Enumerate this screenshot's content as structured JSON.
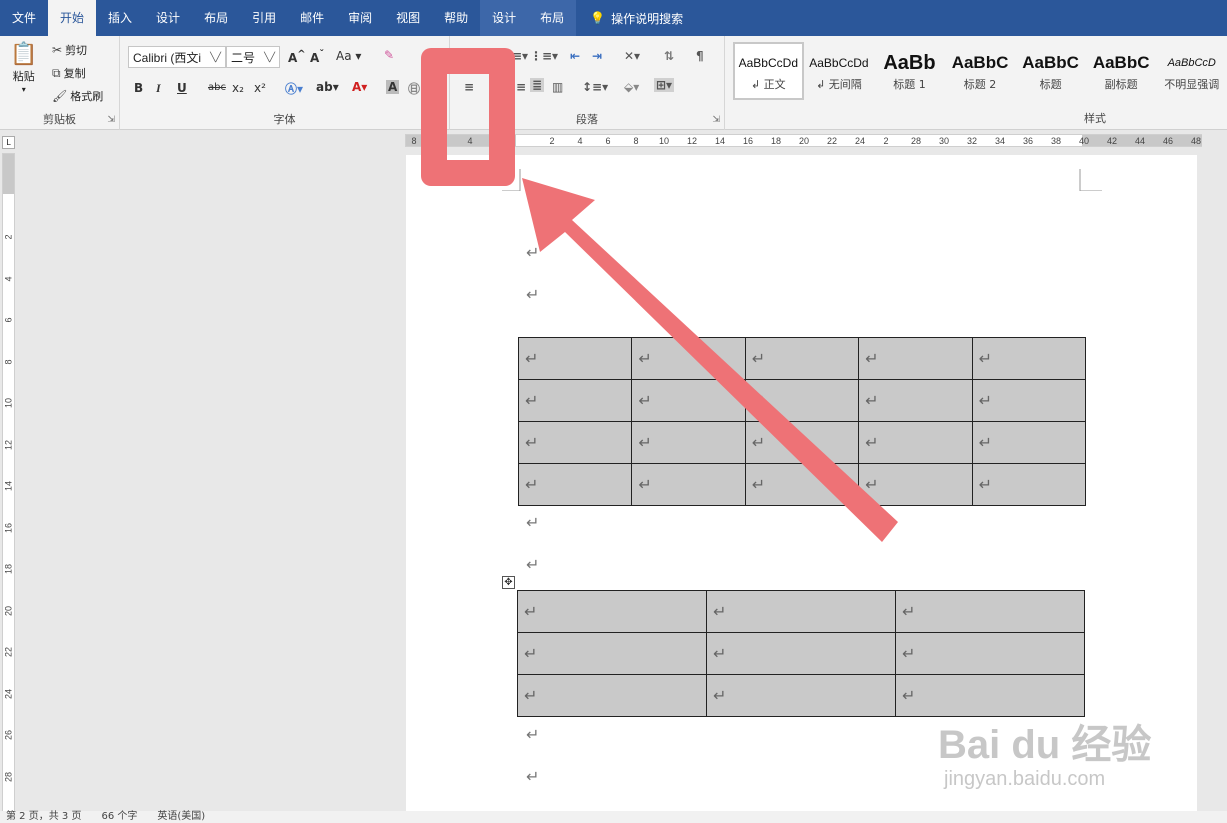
{
  "tabs": [
    "文件",
    "开始",
    "插入",
    "设计",
    "布局",
    "引用",
    "邮件",
    "审阅",
    "视图",
    "帮助",
    "设计",
    "布局"
  ],
  "active_tab_index": 1,
  "tell_me": "操作说明搜索",
  "clipboard": {
    "paste": "粘贴",
    "cut": "剪切",
    "copy": "复制",
    "format_painter": "格式刷",
    "label": "剪贴板"
  },
  "font": {
    "name": "Calibri (西文i",
    "size": "二号",
    "grow": "A",
    "shrink": "A",
    "case": "Aa",
    "bold": "B",
    "italic": "I",
    "underline": "U",
    "strike": "abc",
    "subscript": "x₂",
    "superscript": "x²",
    "label": "字体"
  },
  "paragraph": {
    "label": "段落"
  },
  "styles": {
    "label": "样式",
    "items": [
      {
        "sample": "AaBbCcDd",
        "name": "↲ 正文"
      },
      {
        "sample": "AaBbCcDd",
        "name": "↲ 无间隔"
      },
      {
        "sample": "AaBb",
        "name": "标题 1"
      },
      {
        "sample": "AaBbC",
        "name": "标题 2"
      },
      {
        "sample": "AaBbC",
        "name": "标题"
      },
      {
        "sample": "AaBbC",
        "name": "副标题"
      },
      {
        "sample": "AaBbCcD",
        "name": "不明显强调"
      }
    ]
  },
  "hruler_ticks": [
    "8",
    "4",
    "2",
    "4",
    "6",
    "8",
    "10",
    "12",
    "14",
    "16",
    "18",
    "20",
    "22",
    "24",
    "2",
    "28",
    "30",
    "32",
    "34",
    "36",
    "38",
    "40",
    "42",
    "44",
    "46",
    "48"
  ],
  "vruler_ticks": [
    "2",
    "4",
    "6",
    "8",
    "10",
    "12",
    "14",
    "16",
    "18",
    "20",
    "22",
    "24",
    "26",
    "28"
  ],
  "para_mark": "↵",
  "status": {
    "page": "第 2 页，共 3 页",
    "words": "66 个字",
    "lang": "英语(美国)"
  },
  "watermark": {
    "brand": "Bai du 经验",
    "url": "jingyan.baidu.com"
  },
  "colors": {
    "ribbon_blue": "#2b579a",
    "highlight_red": "#ee7276",
    "cell_gray": "#c9c9c9"
  }
}
